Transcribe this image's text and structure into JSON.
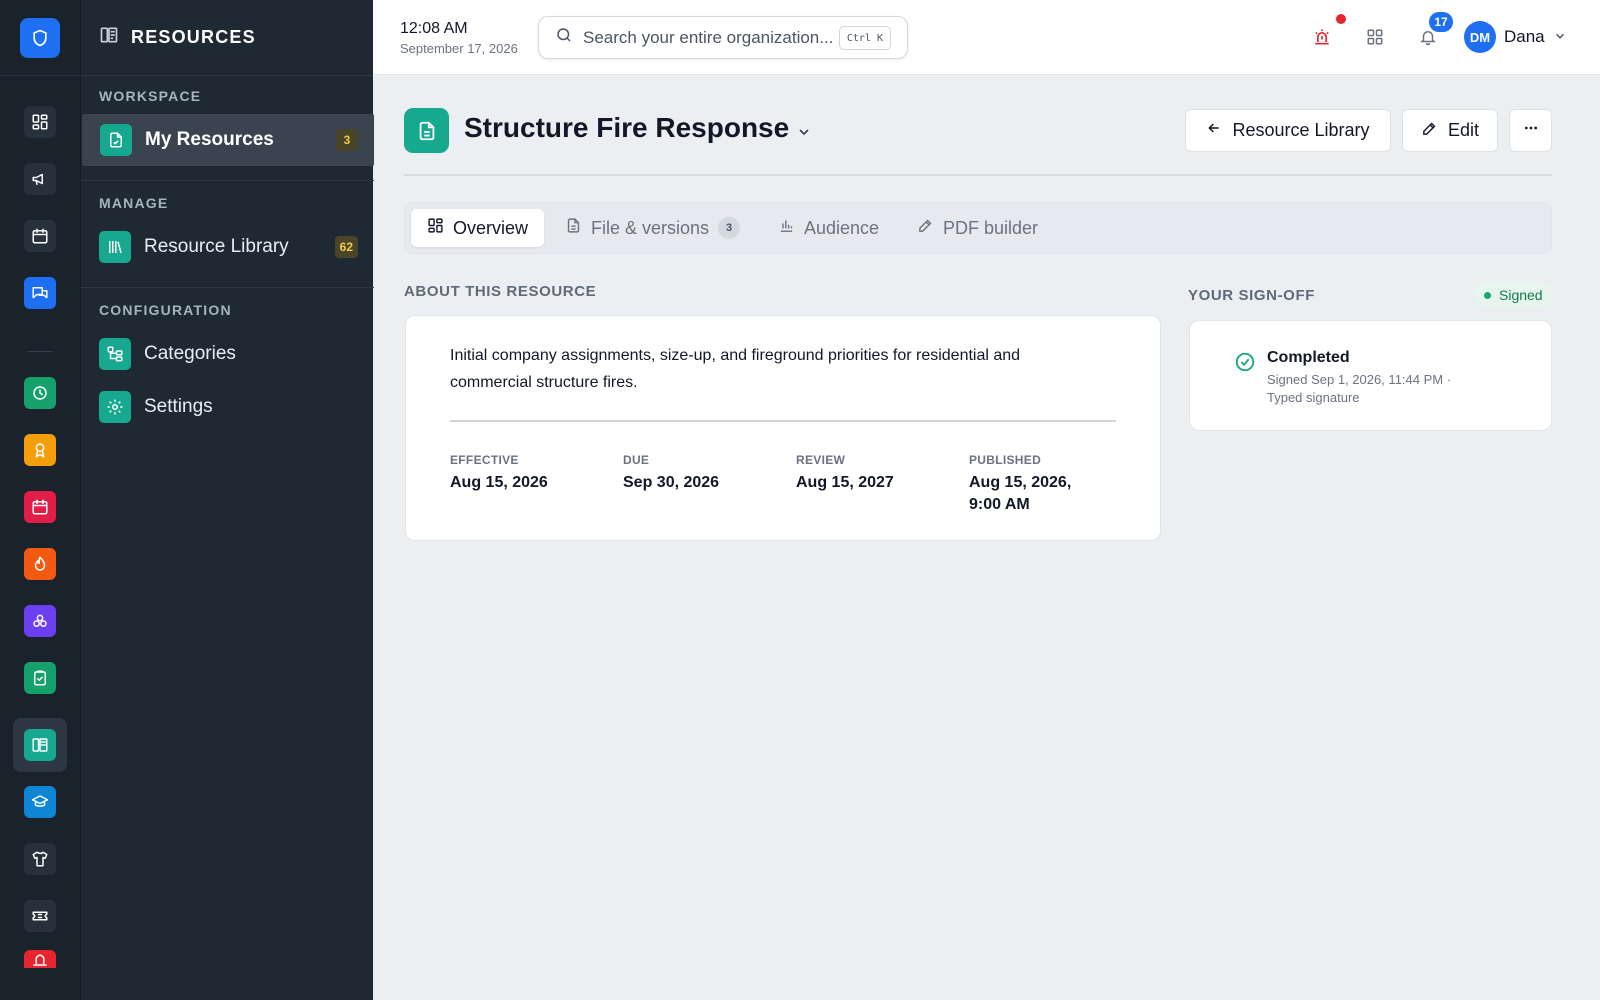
{
  "rail": {
    "items": [
      {
        "name": "dashboard-icon",
        "bg": "#26313c"
      },
      {
        "name": "megaphone-icon",
        "bg": "#26313c"
      },
      {
        "name": "calendar-icon",
        "bg": "#26313c"
      },
      {
        "name": "chat-icon",
        "bg": "#1e6ff2"
      },
      {
        "name": "clock-icon",
        "bg": "#16a06a"
      },
      {
        "name": "award-icon",
        "bg": "#f59e0b"
      },
      {
        "name": "schedule-icon",
        "bg": "#e11d48"
      },
      {
        "name": "flame-icon",
        "bg": "#f25a12"
      },
      {
        "name": "biohazard-icon",
        "bg": "#6d3ff2"
      },
      {
        "name": "clipboard-check-icon",
        "bg": "#16a06a"
      },
      {
        "name": "resources-icon",
        "bg": "#17a98f",
        "active": true
      },
      {
        "name": "graduation-cap-icon",
        "bg": "#0e86d4"
      },
      {
        "name": "uniform-shirt-icon",
        "bg": "#26313c"
      },
      {
        "name": "ticket-icon",
        "bg": "#26313c"
      },
      {
        "name": "alarm-icon",
        "bg": "#e5262e"
      }
    ]
  },
  "nav": {
    "title": "RESOURCES",
    "sections": {
      "workspace": "WORKSPACE",
      "manage": "MANAGE",
      "configuration": "CONFIGURATION"
    },
    "items": {
      "my_resources": {
        "label": "My Resources",
        "badge": "3"
      },
      "resource_library": {
        "label": "Resource Library",
        "badge": "62"
      },
      "categories": {
        "label": "Categories"
      },
      "settings": {
        "label": "Settings"
      }
    }
  },
  "topbar": {
    "time": "12:08 AM",
    "date": "September 17, 2026",
    "search_placeholder": "Search your entire organization...",
    "search_shortcut": "Ctrl K",
    "notifications_count": "17",
    "user_initials": "DM",
    "user_name": "Dana"
  },
  "page": {
    "title": "Structure Fire Response",
    "back_button": "Resource Library",
    "edit_button": "Edit",
    "tabs": {
      "overview": "Overview",
      "files": "File & versions",
      "files_count": "3",
      "audience": "Audience",
      "pdf_builder": "PDF builder"
    },
    "about": {
      "heading": "ABOUT THIS RESOURCE",
      "description": "Initial company assignments, size-up, and fireground priorities for residential and commercial structure fires.",
      "meta": [
        {
          "label": "EFFECTIVE",
          "value": "Aug 15, 2026"
        },
        {
          "label": "DUE",
          "value": "Sep 30, 2026"
        },
        {
          "label": "REVIEW",
          "value": "Aug 15, 2027"
        },
        {
          "label": "PUBLISHED",
          "value": "Aug 15, 2026, 9:00 AM"
        }
      ]
    },
    "signoff": {
      "heading": "YOUR SIGN-OFF",
      "status": "Signed",
      "title": "Completed",
      "detail_line1": "Signed Sep 1, 2026, 11:44 PM ·",
      "detail_line2": "Typed signature"
    }
  },
  "colors": {
    "accent": "#1e6ff2",
    "teal": "#17a98f",
    "signed_green": "#0f7b4a"
  }
}
